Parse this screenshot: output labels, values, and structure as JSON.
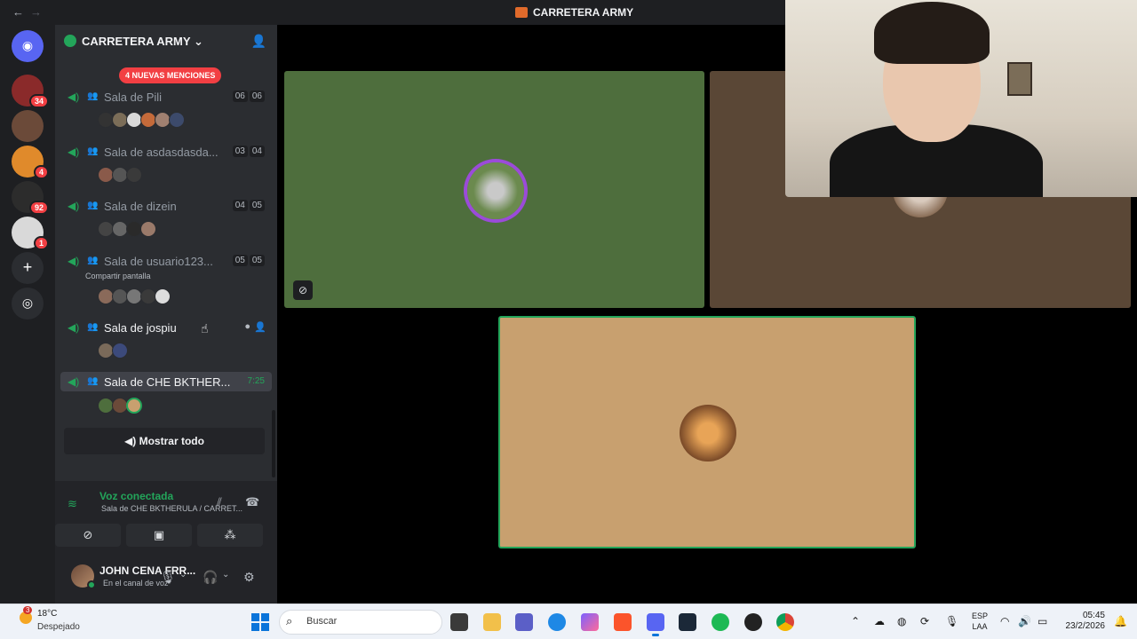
{
  "window": {
    "back_glyph": "←",
    "forward_glyph": "→",
    "title": "CARRETERA ARMY"
  },
  "guilds": [
    {
      "badge": "34",
      "color": "#8a2a2a"
    },
    {
      "badge": "",
      "color": "#6b4a39"
    },
    {
      "badge": "4",
      "color": "#e08a2b"
    },
    {
      "badge": "92",
      "color": "#2c2c2c"
    },
    {
      "badge": "1",
      "color": "#d9d9d9"
    }
  ],
  "server": {
    "name": "CARRETERA ARMY",
    "mentions_banner": "4 NUEVAS MENCIONES"
  },
  "channels": [
    {
      "name": "Sala de Pili",
      "count_a": "06",
      "count_b": "06"
    },
    {
      "name": "Sala de asdasdasda...",
      "count_a": "03",
      "count_b": "04"
    },
    {
      "name": "Sala de dizein",
      "count_a": "04",
      "count_b": "05"
    },
    {
      "name": "Sala de usuario123...",
      "count_a": "05",
      "count_b": "05",
      "sublabel": "Compartir pantalla"
    },
    {
      "name": "Sala de jospiu"
    },
    {
      "name": "Sala de CHE BKTHER...",
      "time": "7:25"
    }
  ],
  "show_all": "Mostrar todo",
  "voice": {
    "status": "Voz conectada",
    "channel": "Sala de CHE BKTHERULA / CARRET..."
  },
  "user": {
    "name": "JOHN CENA FRR...",
    "status": "En el canal de voz"
  },
  "taskbar": {
    "temperature": "18°C",
    "weather": "Despejado",
    "weather_badge": "3",
    "search_placeholder": "Buscar",
    "lang_top": "ESP",
    "lang_bottom": "LAA",
    "time": "05:45",
    "date": "23/2/2026"
  },
  "colors": {
    "online_green": "#23a55a",
    "mention_red": "#f23f43",
    "speaking_purple": "#9b4bd9"
  }
}
